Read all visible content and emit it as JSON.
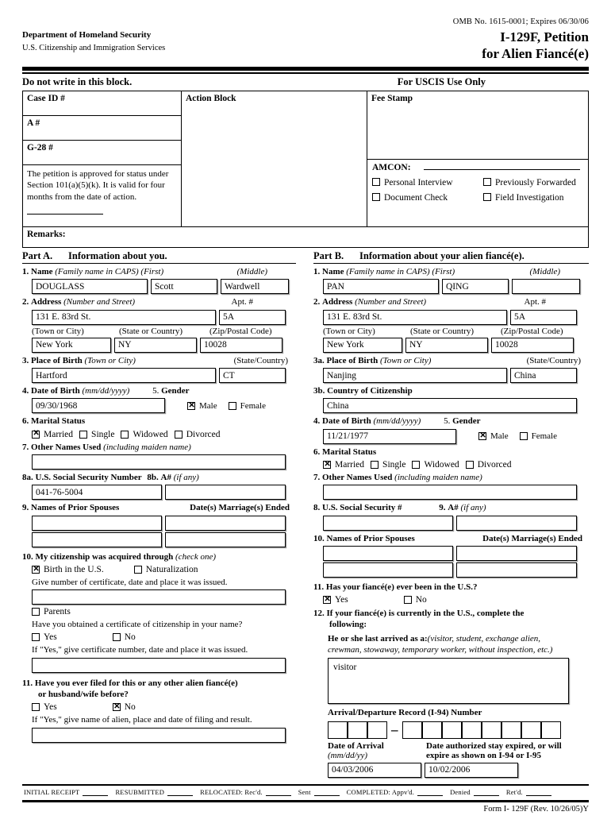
{
  "header": {
    "omb": "OMB No. 1615-0001;  Expires 06/30/06",
    "agency_line1": "Department of Homeland Security",
    "agency_line2": "U.S. Citizenship and Immigration Services",
    "form_title_line1": "I-129F, Petition",
    "form_title_line2": "for Alien Fiancé(e)",
    "do_not_write": "Do not write in this block.",
    "uscis_use_only": "For USCIS Use Only"
  },
  "uscis_block": {
    "case_id_label": "Case ID #",
    "a_number_label": "A #",
    "g28_label": "G-28 #",
    "action_block_label": "Action Block",
    "fee_stamp_label": "Fee Stamp",
    "approval_text": "The petition is approved for status under Section 101(a)(5)(k).  It is valid for four months from the date of action.",
    "amcon_label": "AMCON:",
    "checkboxes": [
      {
        "label": "Personal Interview",
        "checked": false
      },
      {
        "label": "Previously Forwarded",
        "checked": false
      },
      {
        "label": "Document Check",
        "checked": false
      },
      {
        "label": "Field Investigation",
        "checked": false
      }
    ],
    "remarks_label": "Remarks:"
  },
  "part_a": {
    "part_label": "Part A.",
    "title": "Information about you.",
    "q1": {
      "num": "1.",
      "label": "Name",
      "hint_family": "(Family name in CAPS)",
      "hint_first": "(First)",
      "hint_middle": "(Middle)",
      "family": "DOUGLASS",
      "first": "Scott",
      "middle": "Wardwell"
    },
    "q2": {
      "num": "2.",
      "label": "Address",
      "hint": "(Number and Street)",
      "apt_label": "Apt. #",
      "street": "131 E. 83rd St.",
      "apt": "5A",
      "town_label": "(Town or City)",
      "state_label": "(State or Country)",
      "zip_label": "(Zip/Postal Code)",
      "town": "New York",
      "state": "NY",
      "zip": "10028"
    },
    "q3": {
      "num": "3.",
      "label": "Place of Birth",
      "hint": "(Town or City)",
      "state_hint": "(State/Country)",
      "town": "Hartford",
      "state": "CT"
    },
    "q4": {
      "num": "4.",
      "label": "Date of Birth",
      "hint": "(mm/dd/yyyy)",
      "value": "09/30/1968"
    },
    "q5": {
      "num": "5.",
      "label": "Gender",
      "options": [
        {
          "label": "Male",
          "checked": true
        },
        {
          "label": "Female",
          "checked": false
        }
      ]
    },
    "q6": {
      "num": "6.",
      "label": "Marital Status",
      "options": [
        {
          "label": "Married",
          "checked": true
        },
        {
          "label": "Single",
          "checked": false
        },
        {
          "label": "Widowed",
          "checked": false
        },
        {
          "label": "Divorced",
          "checked": false
        }
      ]
    },
    "q7": {
      "num": "7.",
      "label": "Other Names Used",
      "hint": "(including maiden name)",
      "value": ""
    },
    "q8": {
      "a_num": "8a.",
      "a_label": "U.S. Social Security Number",
      "b_num": "8b.",
      "b_label": "A#",
      "b_hint": "(if any)",
      "ssn": "041-76-5004",
      "anum": ""
    },
    "q9": {
      "num": "9.",
      "label": "Names of Prior Spouses",
      "dates_label": "Date(s) Marriage(s) Ended",
      "rows": [
        {
          "name": "",
          "date": ""
        },
        {
          "name": "",
          "date": ""
        }
      ]
    },
    "q10": {
      "num": "10.",
      "label": "My citizenship was acquired through",
      "hint": "(check one)",
      "options": [
        {
          "label": "Birth in the U.S.",
          "checked": true
        },
        {
          "label": "Naturalization",
          "checked": false
        }
      ],
      "cert_instruction": "Give number of certificate, date and place it was issued.",
      "cert_value": "",
      "parents": {
        "label": "Parents",
        "checked": false
      },
      "cert_question": "Have you obtained a certificate of citizenship in your name?",
      "yesno": [
        {
          "label": "Yes",
          "checked": false
        },
        {
          "label": "No",
          "checked": false
        }
      ],
      "if_yes": "If \"Yes,\" give certificate number, date and place it was issued.",
      "if_yes_value": ""
    },
    "q11": {
      "num": "11.",
      "label_line1": "Have you ever filed for this or any other alien fiancé(e)",
      "label_line2": "or husband/wife before?",
      "yesno": [
        {
          "label": "Yes",
          "checked": false
        },
        {
          "label": "No",
          "checked": true
        }
      ],
      "if_yes": "If \"Yes,\" give name of alien, place and date of filing and result.",
      "if_yes_value": ""
    }
  },
  "part_b": {
    "part_label": "Part B.",
    "title": "Information about your alien fiancé(e).",
    "q1": {
      "num": "1.",
      "label": "Name",
      "hint_family": "(Family name in CAPS)",
      "hint_first": "(First)",
      "hint_middle": "(Middle)",
      "family": "PAN",
      "first": "QING",
      "middle": ""
    },
    "q2": {
      "num": "2.",
      "label": "Address",
      "hint": "(Number and Street)",
      "apt_label": "Apt. #",
      "street": "131 E. 83rd St.",
      "apt": "5A",
      "town_label": "(Town or City)",
      "state_label": "(State or Country)",
      "zip_label": "(Zip/Postal Code)",
      "town": "New York",
      "state": "NY",
      "zip": "10028"
    },
    "q3a": {
      "num": "3a.",
      "label": "Place of Birth",
      "hint": "(Town or City)",
      "state_hint": "(State/Country)",
      "town": "Nanjing",
      "state": "China"
    },
    "q3b": {
      "num": "3b.",
      "label": "Country of Citizenship",
      "value": "China"
    },
    "q4": {
      "num": "4.",
      "label": "Date of Birth",
      "hint": "(mm/dd/yyyy)",
      "value": "11/21/1977"
    },
    "q5": {
      "num": "5.",
      "label": "Gender",
      "options": [
        {
          "label": "Male",
          "checked": true
        },
        {
          "label": "Female",
          "checked": false
        }
      ]
    },
    "q6": {
      "num": "6.",
      "label": "Marital Status",
      "options": [
        {
          "label": "Married",
          "checked": true
        },
        {
          "label": "Single",
          "checked": false
        },
        {
          "label": "Widowed",
          "checked": false
        },
        {
          "label": "Divorced",
          "checked": false
        }
      ]
    },
    "q7": {
      "num": "7.",
      "label": "Other Names Used",
      "hint": "(including maiden name)",
      "value": ""
    },
    "q8": {
      "num": "8.",
      "label": "U.S. Social Security #",
      "value": "",
      "a_num": "9.",
      "a_label": "A#",
      "a_hint": "(if any)",
      "a_value": ""
    },
    "q10": {
      "num": "10.",
      "label": "Names of Prior Spouses",
      "dates_label": "Date(s) Marriage(s) Ended",
      "rows": [
        {
          "name": "",
          "date": ""
        },
        {
          "name": "",
          "date": ""
        }
      ]
    },
    "q11": {
      "num": "11.",
      "label": "Has your fiancé(e) ever been in the U.S.?",
      "yesno": [
        {
          "label": "Yes",
          "checked": true
        },
        {
          "label": "No",
          "checked": false
        }
      ]
    },
    "q12": {
      "num": "12.",
      "label_line1": "If your fiancé(e) is currently in the U.S., complete the",
      "label_line2": "following:",
      "arrived_label": "He or she last arrived as a:",
      "arrived_hint_line1": "(visitor, student, exchange alien,",
      "arrived_hint_line2": "crewman, stowaway, temporary worker, without inspection, etc.)",
      "arrived_value": "visitor",
      "i94_label": "Arrival/Departure Record (I-94) Number",
      "i94_left_boxes": 3,
      "i94_right_boxes": 8,
      "i94_left": [
        "",
        "",
        ""
      ],
      "i94_right": [
        "",
        "",
        "",
        "",
        "",
        "",
        "",
        ""
      ],
      "arrival_label_line1": "Date of Arrival",
      "arrival_label_line2": "(mm/dd/yy)",
      "expire_label_line1": "Date authorized stay expired, or will",
      "expire_label_line2": "expire as shown on I-94 or I-95",
      "arrival_date": "04/03/2006",
      "expire_date": "10/02/2006"
    }
  },
  "footer": {
    "initial_receipt": "INITIAL RECEIPT",
    "resubmitted": "RESUBMITTED",
    "relocated": "RELOCATED:  Rec'd.",
    "sent": "Sent",
    "completed": "COMPLETED:  Appv'd.",
    "denied": "Denied",
    "retd": "Ret'd.",
    "form_rev": "Form I- 129F (Rev. 10/26/05)Y"
  }
}
